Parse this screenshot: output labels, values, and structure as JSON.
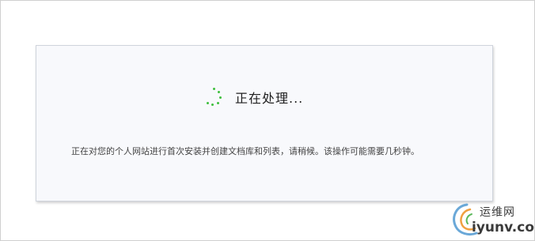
{
  "dialog": {
    "status_text": "正在处理...",
    "description": "正在对您的个人网站进行首次安装并创建文档库和列表，请稍候。该操作可能需要几秒钟。"
  },
  "watermark": {
    "title": "运维网",
    "url": "iyunv.com"
  },
  "icons": {
    "spinner": "loading-spinner-icon"
  },
  "colors": {
    "spinner": "#3fbf3f",
    "dialog_background": "#f8f9fc",
    "dialog_border": "#cfd4dc"
  }
}
